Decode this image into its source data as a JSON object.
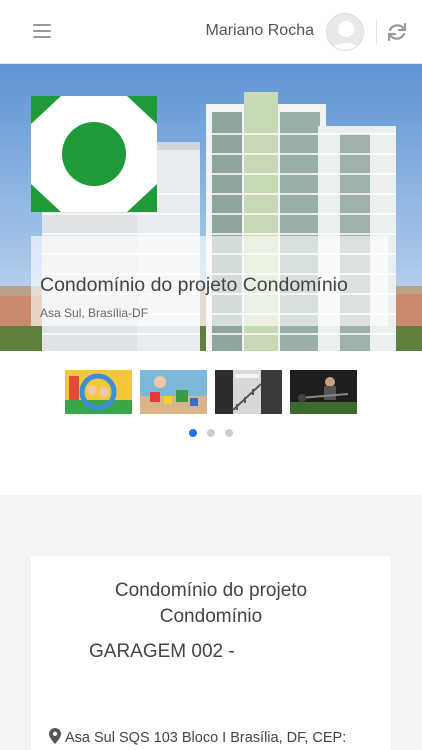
{
  "header": {
    "user_name": "Mariano Rocha",
    "icons": {
      "menu": "hamburger-icon",
      "avatar": "user-avatar",
      "refresh": "refresh-icon"
    }
  },
  "hero": {
    "title": "Condomínio do projeto Condomínio",
    "location": "Asa Sul, Brasília-DF",
    "logo_colors": {
      "outer": "#1f9a3a",
      "inner": "#ffffff",
      "center": "#1f9a3a"
    }
  },
  "gallery": {
    "thumbnails": [
      "playground-photo",
      "toy-room-photo",
      "staircase-photo",
      "gym-photo"
    ],
    "active_dot": 0,
    "dots": 3
  },
  "detail": {
    "title_line1": "Condomínio do projeto",
    "title_line2": "Condomínio",
    "unit": "GARAGEM 002 -",
    "address": "Asa Sul SQS 103 Bloco I Brasília, DF, CEP:"
  },
  "colors": {
    "accent": "#1a73e8",
    "background": "#f2f3f5"
  }
}
